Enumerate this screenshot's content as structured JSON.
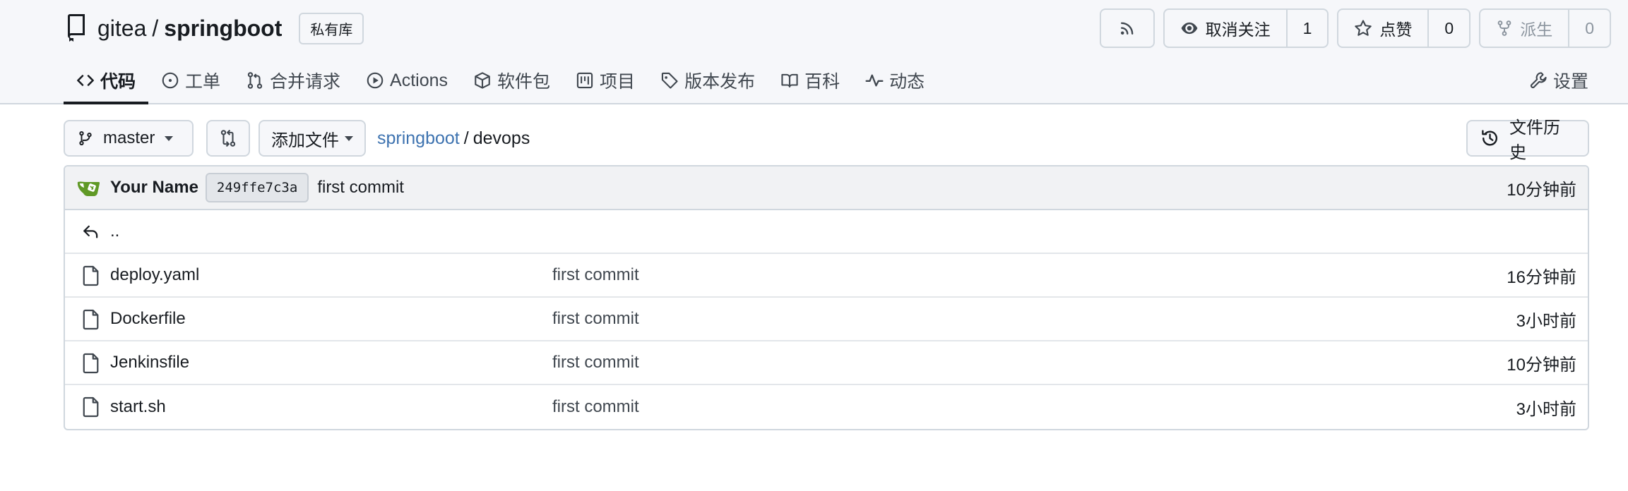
{
  "repo": {
    "owner": "gitea",
    "separator": "/",
    "name": "springboot",
    "private_label": "私有库"
  },
  "actions": {
    "watch_label": "取消关注",
    "watch_count": "1",
    "star_label": "点赞",
    "star_count": "0",
    "fork_label": "派生",
    "fork_count": "0"
  },
  "tabs": [
    {
      "label": "代码",
      "icon": "code-icon",
      "active": true
    },
    {
      "label": "工单",
      "icon": "issue-icon"
    },
    {
      "label": "合并请求",
      "icon": "pull-request-icon"
    },
    {
      "label": "Actions",
      "icon": "play-icon"
    },
    {
      "label": "软件包",
      "icon": "package-icon"
    },
    {
      "label": "项目",
      "icon": "project-icon"
    },
    {
      "label": "版本发布",
      "icon": "tag-icon"
    },
    {
      "label": "百科",
      "icon": "book-icon"
    },
    {
      "label": "动态",
      "icon": "pulse-icon"
    }
  ],
  "settings_label": "设置",
  "toolbar": {
    "branch": "master",
    "add_file": "添加文件",
    "breadcrumb_repo": "springboot",
    "breadcrumb_sep": "/",
    "breadcrumb_dir": "devops",
    "history_label": "文件历史"
  },
  "latest_commit": {
    "author": "Your Name",
    "sha": "249ffe7c3a",
    "message": "first commit",
    "time": "10分钟前"
  },
  "parent_dir": "..",
  "files": [
    {
      "name": "deploy.yaml",
      "message": "first commit",
      "time": "16分钟前"
    },
    {
      "name": "Dockerfile",
      "message": "first commit",
      "time": "3小时前"
    },
    {
      "name": "Jenkinsfile",
      "message": "first commit",
      "time": "10分钟前"
    },
    {
      "name": "start.sh",
      "message": "first commit",
      "time": "3小时前"
    }
  ],
  "colors": {
    "header_bg": "#f6f7fa",
    "link": "#3e73b0",
    "border": "#d0d7de",
    "avatar_green": "#609926"
  }
}
